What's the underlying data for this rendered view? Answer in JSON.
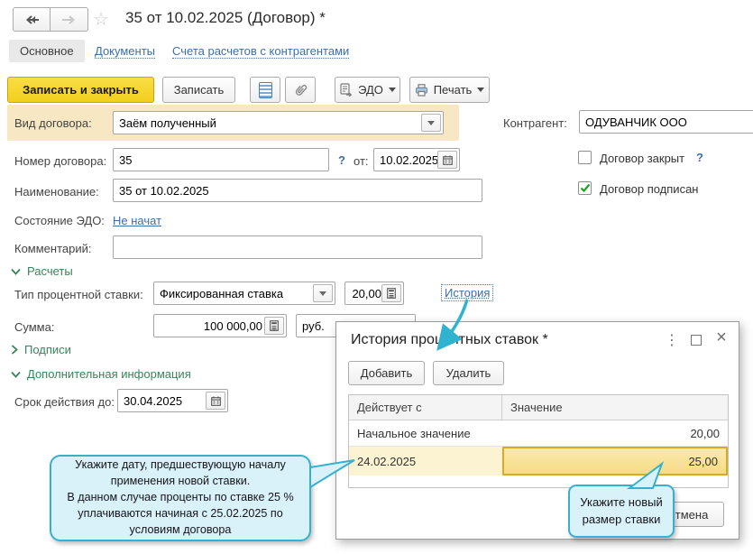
{
  "header": {
    "title": "35 от 10.02.2025 (Договор) *",
    "favorite_icon": "☆"
  },
  "tabs": {
    "main": "Основное",
    "documents": "Документы",
    "accounts": "Счета расчетов с контрагентами"
  },
  "toolbar": {
    "save_close": "Записать и закрыть",
    "save": "Записать",
    "edo": "ЭДО",
    "print": "Печать"
  },
  "form": {
    "kind_label": "Вид договора:",
    "kind_value": "Заём полученный",
    "counterparty_label": "Контрагент:",
    "counterparty_value": "ОДУВАНЧИК ООО",
    "number_label": "Номер договора:",
    "number_value": "35",
    "from_label": "от:",
    "from_date": "10.02.2025",
    "closed_label": "Договор закрыт",
    "signed_label": "Договор подписан",
    "name_label": "Наименование:",
    "name_value": "35 от 10.02.2025",
    "edo_state_label": "Состояние ЭДО:",
    "edo_state_value": "Не начат",
    "comment_label": "Комментарий:",
    "help_icon": "?"
  },
  "sections": {
    "calc": "Расчеты",
    "signatures": "Подписи",
    "extra": "Дополнительная информация"
  },
  "calc": {
    "rate_type_label": "Тип процентной ставки:",
    "rate_type_value": "Фиксированная ставка",
    "rate_value": "20,00",
    "history_link": "История",
    "sum_label": "Сумма:",
    "sum_value": "100 000,00",
    "currency_value": "руб."
  },
  "extra": {
    "valid_until_label": "Срок действия до:",
    "valid_until_value": "30.04.2025"
  },
  "popup": {
    "title": "История процентных ставок *",
    "icon_more": "⋮",
    "icon_close": "×",
    "add_button": "Добавить",
    "delete_button": "Удалить",
    "col_date": "Действует с",
    "col_value": "Значение",
    "rows": [
      {
        "date": "Начальное значение",
        "value": "20,00"
      },
      {
        "date": "24.02.2025",
        "value": "25,00"
      }
    ],
    "cancel_button": "Отмена"
  },
  "callouts": {
    "date_hint": "Укажите дату, предшествующую началу применения новой ставки.\nВ данном случае проценты по ставке 25 % уплачиваются начиная с 25.02.2025 по условиям договора",
    "rate_hint": "Укажите новый размер ставки"
  },
  "colors": {
    "accent_yellow": "#f2cf1d",
    "required_highlight": "#f7e7c3",
    "selection_yellow": "#f6dc82",
    "selection_border": "#dba928",
    "link_blue": "#3a6fae",
    "section_green": "#35855a",
    "callout_cyan": "#35b0d0",
    "callout_fill": "#d9f1f9"
  }
}
